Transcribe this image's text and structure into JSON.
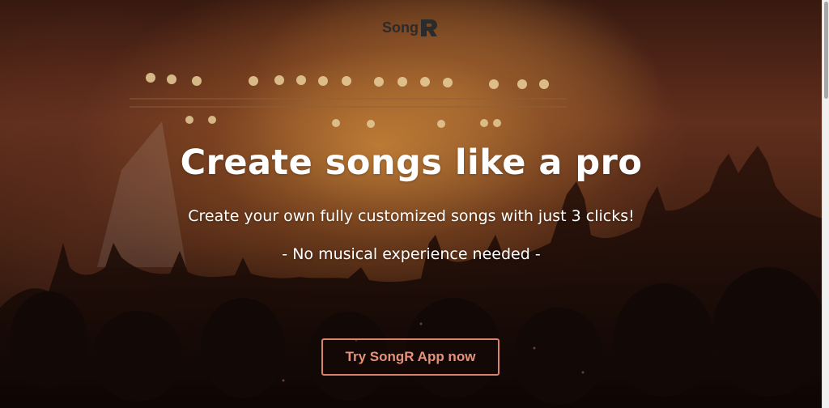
{
  "brand": {
    "logo_text": "Song",
    "logo_mark_letter": "R"
  },
  "hero": {
    "headline": "Create songs like a pro",
    "subheadline": "Create your own fully customized songs with just 3 clicks!",
    "tagline": "- No musical experience needed -",
    "cta_label": "Try SongR App now"
  },
  "colors": {
    "cta_accent": "#e4927a",
    "cta_border": "#d8836b",
    "hero_text": "#ffffff",
    "logo_text": "#2b2b2b"
  },
  "icons": {
    "logo": "songr-logo-mark",
    "background": "concert-crowd-photo"
  }
}
